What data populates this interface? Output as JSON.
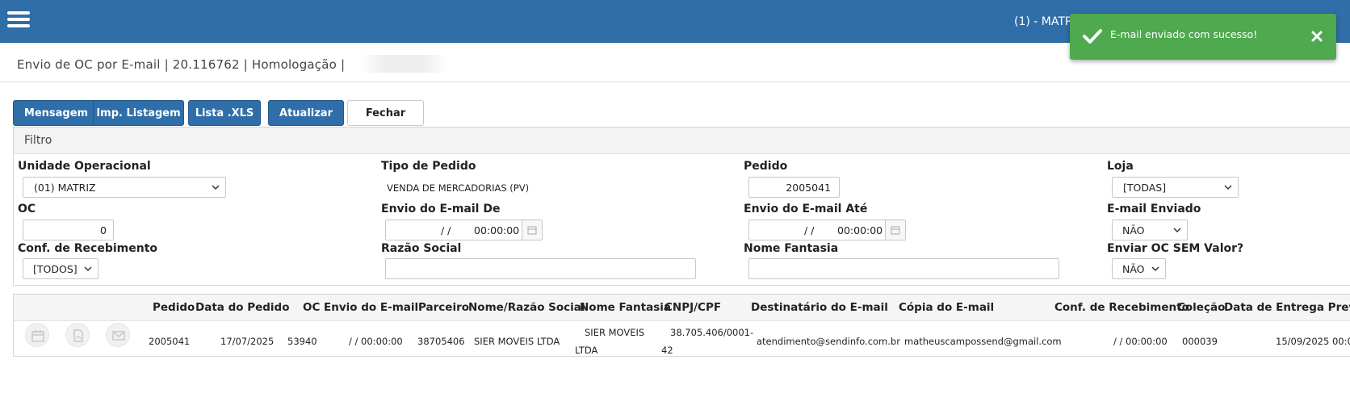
{
  "topbar": {
    "unit_label": "(1) - MATR",
    "bg_color": "#2f6ea8"
  },
  "toast": {
    "message": "E-mail enviado com sucesso!",
    "bg_color": "#4ea94f"
  },
  "page": {
    "title": "Envio de OC por E-mail | 20.116762 | Homologação |"
  },
  "toolbar": {
    "mensagem": "Mensagem",
    "imp_listagem": "Imp. Listagem",
    "lista_xls": "Lista .XLS",
    "atualizar": "Atualizar",
    "fechar": "Fechar"
  },
  "filter": {
    "title": "Filtro",
    "unidade_label": "Unidade Operacional",
    "unidade_value": "(01) MATRIZ",
    "tipo_label": "Tipo de Pedido",
    "tipo_value": "VENDA DE MERCADORIAS (PV)",
    "pedido_label": "Pedido",
    "pedido_value": "2005041",
    "loja_label": "Loja",
    "loja_value": "[TODAS]",
    "oc_label": "OC",
    "oc_value": "0",
    "envio_de_label": "Envio do E-mail De",
    "envio_de_date": "/  /",
    "envio_de_time": "00:00:00",
    "envio_ate_label": "Envio do E-mail Até",
    "envio_ate_date": "/  /",
    "envio_ate_time": "00:00:00",
    "email_enviado_label": "E-mail Enviado",
    "email_enviado_value": "NÃO",
    "conf_label": "Conf. de Recebimento",
    "conf_value": "[TODOS]",
    "razao_label": "Razão Social",
    "razao_value": "",
    "fantasia_label": "Nome Fantasia",
    "fantasia_value": "",
    "sem_valor_label": "Enviar OC SEM Valor?",
    "sem_valor_value": "NÃO"
  },
  "grid": {
    "headers": {
      "pedido": "Pedido",
      "data_pedido": "Data do Pedido",
      "oc": "OC",
      "envio_email": "Envio do E-mail",
      "parceiro": "Parceiro",
      "razao": "Nome/Razão Social",
      "fantasia": "Nome Fantasia",
      "cnpj": "CNPJ/CPF",
      "destinatario": "Destinatário do E-mail",
      "copia": "Cópia do E-mail",
      "conf": "Conf. de Recebimento",
      "colecao": "Coleção",
      "entrega": "Data de Entrega Previst"
    },
    "rows": [
      {
        "pedido": "2005041",
        "data_pedido": "17/07/2025",
        "oc": "53940",
        "envio_email": "/ / 00:00:00",
        "parceiro": "38705406",
        "razao": "SIER MOVEIS LTDA",
        "fantasia_l1": "SIER MOVEIS",
        "fantasia_l2": "LTDA",
        "cnpj_l1": "38.705.406/0001-",
        "cnpj_l2": "42",
        "destinatario": "atendimento@sendinfo.com.br",
        "copia": "matheuscampossend@gmail.com",
        "conf": "/ / 00:00:00",
        "colecao": "000039",
        "entrega": "15/09/2025 00:0"
      }
    ]
  }
}
